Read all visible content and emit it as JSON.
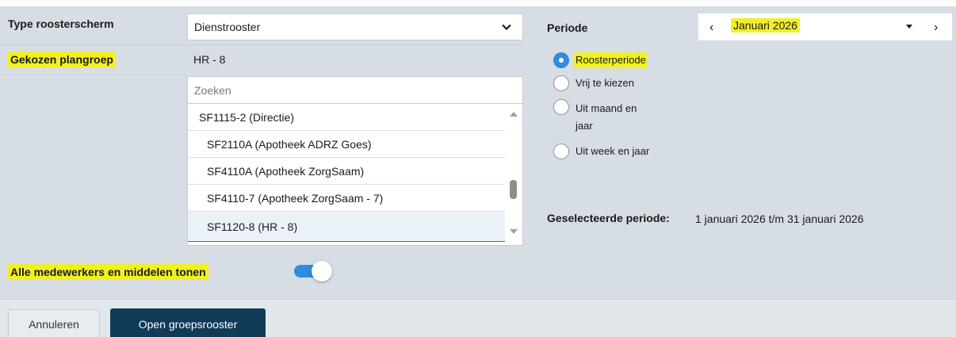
{
  "type_roosterscherm": {
    "label": "Type roosterscherm",
    "selected": "Dienstrooster"
  },
  "plangroep": {
    "label": "Gekozen plangroep",
    "value": "HR - 8"
  },
  "search": {
    "placeholder": "Zoeken"
  },
  "list": {
    "items": [
      {
        "label": "SF1115-2 (Directie)"
      },
      {
        "label": "SF2110A (Apotheek ADRZ Goes)"
      },
      {
        "label": "SF4110A (Apotheek ZorgSaam)"
      },
      {
        "label": "SF4110-7 (Apotheek ZorgSaam - 7)"
      },
      {
        "label": "SF1120-8 (HR - 8)",
        "selected": true
      }
    ]
  },
  "toggle": {
    "label": "Alle medewerkers en middelen tonen",
    "state": "on"
  },
  "periode": {
    "label": "Periode",
    "value": "Januari 2026",
    "prev_icon": "‹",
    "next_icon": "›"
  },
  "radios": [
    {
      "label": "Roosterperiode",
      "checked": true
    },
    {
      "label": "Vrij te kiezen",
      "checked": false
    },
    {
      "label_line1": "Uit maand en",
      "label_line2": "jaar",
      "checked": false
    },
    {
      "label": "Uit week en jaar",
      "checked": false
    }
  ],
  "geselecteerde": {
    "label": "Geselecteerde periode:",
    "value": "1 januari 2026 t/m 31 januari 2026"
  },
  "buttons": {
    "cancel": "Annuleren",
    "open": "Open groepsrooster"
  },
  "colors": {
    "highlight": "#f1f024",
    "accent": "#2f8cde",
    "primary_button": "#0f3b57",
    "background": "#d6dde4"
  }
}
